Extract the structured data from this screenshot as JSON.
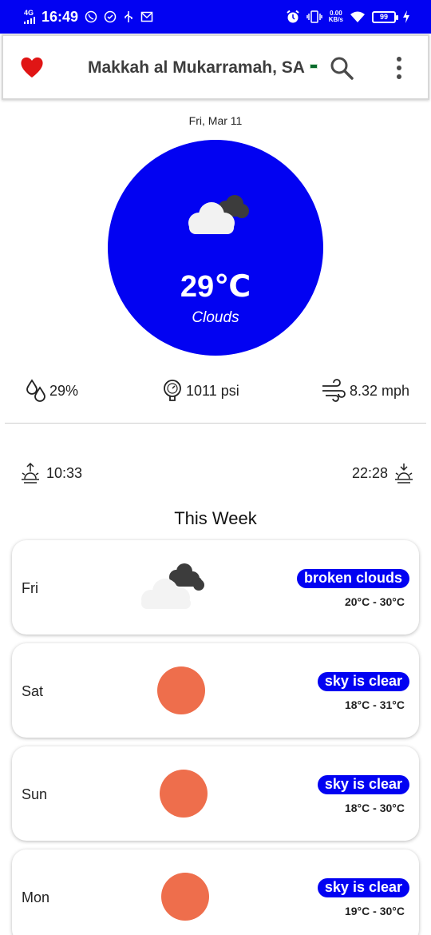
{
  "status_bar": {
    "network": "4G",
    "time": "16:49",
    "kbs_top": "0.00",
    "kbs_bottom": "KB/s",
    "battery": "99"
  },
  "app_bar": {
    "title": "Makkah al Mukarramah, SA"
  },
  "current": {
    "date": "Fri, Mar 11",
    "temperature": "29℃",
    "condition": "Clouds",
    "humidity": "29%",
    "pressure": "1011 psi",
    "wind": "8.32 mph",
    "sunrise": "10:33",
    "sunset": "22:28"
  },
  "week": {
    "title": "This Week",
    "days": [
      {
        "day": "Fri",
        "condition": "broken clouds",
        "range": "20°C - 30°C",
        "icon": "broken-clouds-icon"
      },
      {
        "day": "Sat",
        "condition": "sky is clear",
        "range": "18°C - 31°C",
        "icon": "clear-sky-icon"
      },
      {
        "day": "Sun",
        "condition": "sky is clear",
        "range": "18°C - 30°C",
        "icon": "clear-sky-icon"
      },
      {
        "day": "Mon",
        "condition": "sky is clear",
        "range": "19°C - 30°C",
        "icon": "clear-sky-icon"
      }
    ]
  },
  "colors": {
    "accent": "#0202f2",
    "heart": "#e01515",
    "sun": "#ee6e4c"
  }
}
